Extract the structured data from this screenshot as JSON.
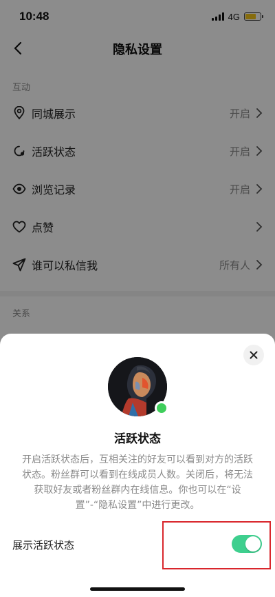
{
  "status_bar": {
    "time": "10:48",
    "network": "4G"
  },
  "nav": {
    "title": "隐私设置"
  },
  "sections": [
    {
      "label": "互动",
      "items": [
        {
          "icon": "location-pin-icon",
          "label": "同城展示",
          "value": "开启"
        },
        {
          "icon": "active-status-icon",
          "label": "活跃状态",
          "value": "开启"
        },
        {
          "icon": "eye-icon",
          "label": "浏览记录",
          "value": "开启"
        },
        {
          "icon": "heart-icon",
          "label": "点赞",
          "value": ""
        },
        {
          "icon": "send-icon",
          "label": "谁可以私信我",
          "value": "所有人"
        }
      ]
    },
    {
      "label": "关系",
      "items": []
    }
  ],
  "sheet": {
    "title": "活跃状态",
    "description": "开启活跃状态后，互相关注的好友可以看到对方的活跃状态。粉丝群可以看到在线成员人数。关闭后，将无法获取好友或者粉丝群内在线信息。你也可以在“设置”-“隐私设置”中进行更改。",
    "toggle_label": "展示活跃状态",
    "toggle_on": true
  },
  "colors": {
    "toggle_on": "#3ecf8e",
    "online_dot": "#3fce5b",
    "highlight": "#d9262c",
    "battery": "#f5c518"
  }
}
